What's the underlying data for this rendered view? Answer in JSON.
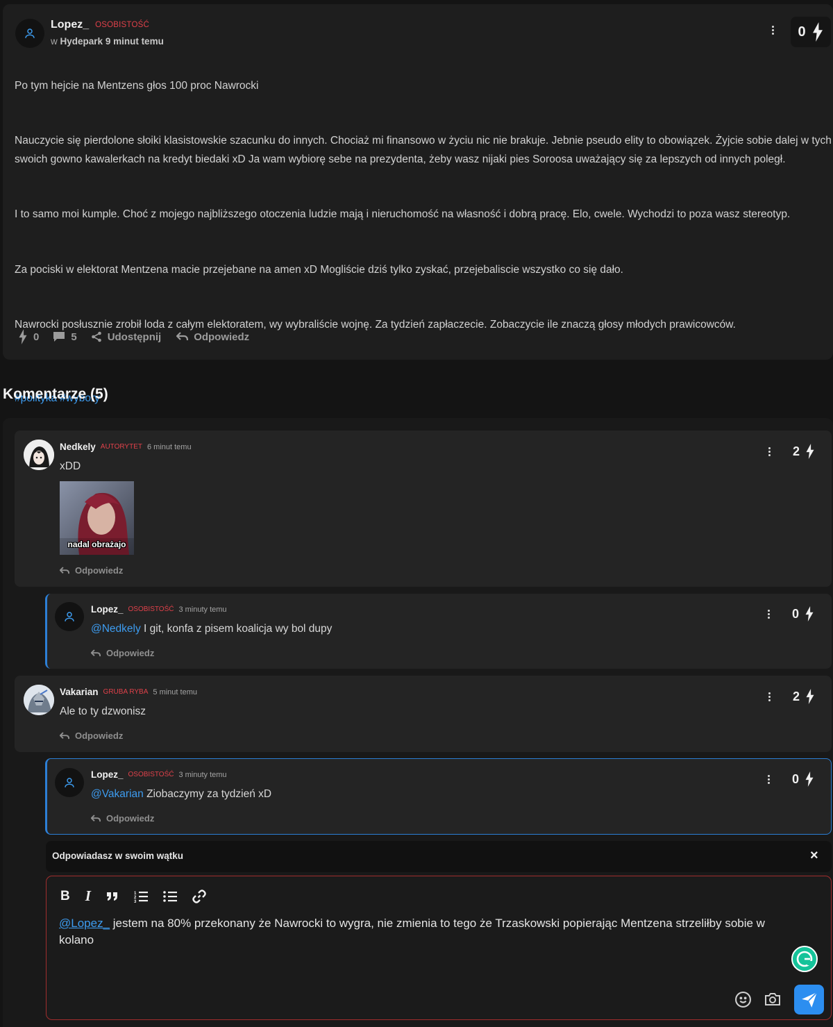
{
  "post": {
    "author": "Lopez_",
    "rank": "OSOBISTOŚĆ",
    "meta_in": "w",
    "group": "Hydepark",
    "time": "9 minut temu",
    "score": "0",
    "paragraphs": [
      "Po tym hejcie na Mentzens głos 100 proc Nawrocki",
      "Nauczycie się pierdolone słoiki klasistowskie szacunku do innych. Chociaż mi finansowo w życiu nic nie brakuje. Jebnie pseudo elity to obowiązek. Żyjcie sobie dalej w tych swoich gowno kawalerkach na kredyt biedaki xD Ja wam wybiorę sebe na prezydenta, żeby wasz nijaki pies Soroosa uważający się za lepszych od innych poległ.",
      "I to samo moi kumple. Choć z mojego najbliższego otoczenia ludzie mają i nieruchomość na własność i dobrą pracę. Elo, cwele. Wychodzi to poza wasz stereotyp.",
      "Za pociski w elektorat Mentzena macie przejebane na amen xD Mogliście dziś tylko zyskać, przejebaliscie wszystko co się dało.",
      "Nawrocki posłusznie zrobił loda z całym elektoratem, wy wybraliście wojnę. Za tydzień zapłaczecie. Zobaczycie ile znaczą głosy młodych prawicowców."
    ],
    "tags": [
      "#polityka",
      "#wybory"
    ],
    "actions": {
      "likes": "0",
      "comments": "5",
      "share": "Udostępnij",
      "reply": "Odpowiedz"
    }
  },
  "comments_header": "Komentarze (5)",
  "comments": [
    {
      "author": "Nedkely",
      "rank": "AUTORYTET",
      "time": "6 minut temu",
      "text": "xDD",
      "image_caption": "nadal obrażajo",
      "score": "2",
      "reply": "Odpowiedz"
    },
    {
      "author": "Lopez_",
      "rank": "OSOBISTOŚĆ",
      "time": "3 minuty temu",
      "mention": "@Nedkely",
      "text": " I git, konfa z pisem koalicja wy bol dupy",
      "score": "0",
      "reply": "Odpowiedz"
    },
    {
      "author": "Vakarian",
      "rank": "GRUBA RYBA",
      "time": "5 minut temu",
      "text": "Ale to ty dzwonisz",
      "score": "2",
      "reply": "Odpowiedz"
    },
    {
      "author": "Lopez_",
      "rank": "OSOBISTOŚĆ",
      "time": "3 minuty temu",
      "mention": "@Vakarian",
      "text": " Ziobaczymy za tydzień xD",
      "score": "0",
      "reply": "Odpowiedz"
    }
  ],
  "reply_bar": {
    "label": "Odpowiadasz w swoim wątku",
    "close": "×"
  },
  "editor": {
    "mention": "@Lopez_",
    "text": " jestem na 80% przekonany że Nawrocki to wygra, nie zmienia to tego że Trzaskowski popierając Mentzena strzeliłby sobie w kolano",
    "toolbar": [
      "bold",
      "italic",
      "quote",
      "ordered-list",
      "bullet-list",
      "link"
    ]
  },
  "colors": {
    "accent": "#3d9cf0",
    "rank": "#e0414a",
    "send": "#2c8ef0",
    "grammarly": "#15c39a"
  }
}
